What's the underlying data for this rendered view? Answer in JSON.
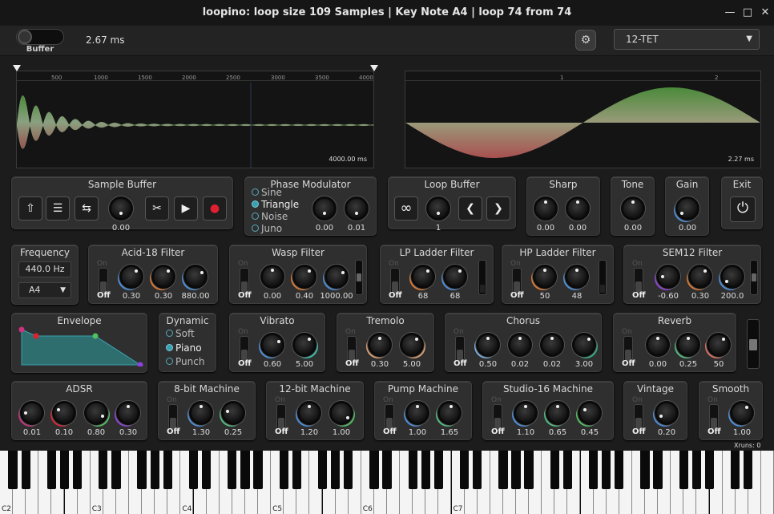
{
  "window": {
    "title": "loopino: loop size 109 Samples | Key Note A4 | loop 74 from 74",
    "minimize_icon": "minimize-icon",
    "maximize_icon": "maximize-icon",
    "close_icon": "close-icon"
  },
  "toolbar": {
    "buffer_label": "Buffer",
    "latency": "2.67 ms",
    "settings_icon": "settings-icon",
    "tuning": "12-TET"
  },
  "sample_view": {
    "ticks": [
      "500",
      "1000",
      "1500",
      "2000",
      "2500",
      "3000",
      "3500",
      "4000"
    ],
    "duration": "4000.00 ms"
  },
  "loop_view": {
    "ticks": [
      "1",
      "2"
    ],
    "duration": "2.27 ms"
  },
  "sample_buffer": {
    "title": "Sample Buffer",
    "value": "0.00"
  },
  "phase_modulator": {
    "title": "Phase Modulator",
    "options": [
      "Sine",
      "Triangle",
      "Noise",
      "Juno"
    ],
    "selected": "Triangle",
    "values": [
      "0.00",
      "0.01"
    ]
  },
  "loop_buffer": {
    "title": "Loop Buffer",
    "value": "1"
  },
  "sharp": {
    "title": "Sharp",
    "values": [
      "0.00",
      "0.00"
    ]
  },
  "tone": {
    "title": "Tone",
    "value": "0.00"
  },
  "gain": {
    "title": "Gain",
    "value": "0.00"
  },
  "exit": {
    "title": "Exit"
  },
  "frequency": {
    "title": "Frequency",
    "value": "440.0 Hz",
    "note": "A4"
  },
  "acid_filter": {
    "title": "Acid-18 Filter",
    "on": "On",
    "off": "Off",
    "values": [
      "0.30",
      "0.30",
      "880.00"
    ]
  },
  "wasp_filter": {
    "title": "Wasp Filter",
    "on": "On",
    "off": "Off",
    "values": [
      "0.00",
      "0.40",
      "1000.00"
    ]
  },
  "lp_ladder": {
    "title": "LP Ladder Filter",
    "on": "On",
    "off": "Off",
    "values": [
      "68",
      "68"
    ]
  },
  "hp_ladder": {
    "title": "HP Ladder Filter",
    "on": "On",
    "off": "Off",
    "values": [
      "50",
      "48"
    ]
  },
  "sem12": {
    "title": "SEM12 Filter",
    "on": "On",
    "off": "Off",
    "values": [
      "-0.60",
      "0.30",
      "200.0"
    ]
  },
  "envelope": {
    "title": "Envelope"
  },
  "dynamic": {
    "title": "Dynamic",
    "options": [
      "Soft",
      "Piano",
      "Punch"
    ],
    "selected": "Piano"
  },
  "vibrato": {
    "title": "Vibrato",
    "on": "On",
    "off": "Off",
    "values": [
      "0.60",
      "5.00"
    ]
  },
  "tremolo": {
    "title": "Tremolo",
    "on": "On",
    "off": "Off",
    "values": [
      "0.30",
      "5.00"
    ]
  },
  "chorus": {
    "title": "Chorus",
    "on": "On",
    "off": "Off",
    "values": [
      "0.50",
      "0.02",
      "0.02",
      "3.00"
    ]
  },
  "reverb": {
    "title": "Reverb",
    "on": "On",
    "off": "Off",
    "values": [
      "0.00",
      "0.25",
      "50"
    ]
  },
  "adsr": {
    "title": "ADSR",
    "values": [
      "0.01",
      "0.10",
      "0.80",
      "0.30"
    ]
  },
  "bit8": {
    "title": "8-bit Machine",
    "on": "On",
    "off": "Off",
    "values": [
      "1.30",
      "0.25"
    ]
  },
  "bit12": {
    "title": "12-bit Machine",
    "on": "On",
    "off": "Off",
    "values": [
      "1.20",
      "1.00"
    ]
  },
  "pump": {
    "title": "Pump Machine",
    "on": "On",
    "off": "Off",
    "values": [
      "1.00",
      "1.65"
    ]
  },
  "studio16": {
    "title": "Studio-16 Machine",
    "on": "On",
    "off": "Off",
    "values": [
      "1.10",
      "0.65",
      "0.45"
    ]
  },
  "vintage": {
    "title": "Vintage",
    "on": "On",
    "off": "Off",
    "value": "0.20"
  },
  "smooth": {
    "title": "Smooth",
    "on": "On",
    "off": "Off",
    "value": "1.00"
  },
  "status": {
    "xruns": "Xruns: 0"
  },
  "keyboard": {
    "octave_labels": [
      "C2",
      "C3",
      "C4",
      "C5",
      "C6",
      "C7"
    ]
  },
  "colors": {
    "accent_teal": "#3aa0b0",
    "red": "#e02030",
    "orange": "#e07a30",
    "blue": "#4a90e0",
    "green": "#50c060",
    "purple": "#9040e0",
    "magenta": "#d03080"
  }
}
